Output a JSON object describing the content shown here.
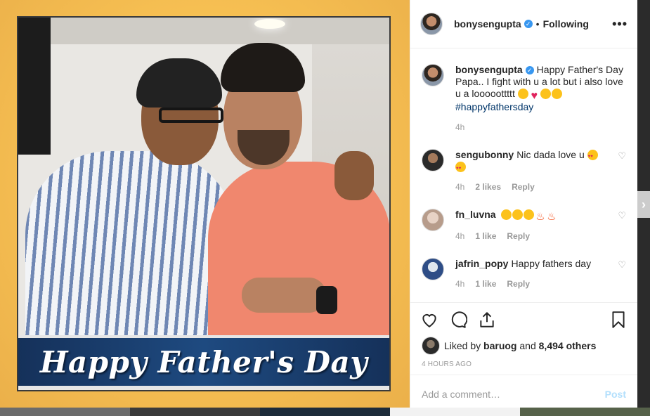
{
  "photo": {
    "banner_text": "Happy Father's Day"
  },
  "header": {
    "username": "bonysengupta",
    "separator": "•",
    "follow_label": "Following",
    "more_label": "•••"
  },
  "caption": {
    "username": "bonysengupta",
    "text": "Happy Father's Day Papa.. I fight with u a lot but i also love u a looooottttt",
    "hashtag": "#happyfathersday",
    "time": "4h"
  },
  "comments": [
    {
      "username": "sengubonny",
      "text": "Nic dada love u",
      "time": "4h",
      "likes": "2 likes",
      "reply": "Reply"
    },
    {
      "username": "fn_luvna",
      "text": "",
      "time": "4h",
      "likes": "1 like",
      "reply": "Reply"
    },
    {
      "username": "jafrin_popy",
      "text": "Happy fathers day",
      "time": "4h",
      "likes": "1 like",
      "reply": "Reply"
    }
  ],
  "likes": {
    "prefix": "Liked by",
    "user": "baruog",
    "and": "and",
    "others": "8,494 others"
  },
  "timestamp": "4 HOURS AGO",
  "add_comment": {
    "placeholder": "Add a comment…",
    "post_label": "Post"
  },
  "colors": {
    "link": "#003569",
    "verified": "#3897f0",
    "post_disabled": "#b2dffc",
    "backdrop": "#f6bf52"
  },
  "icons": [
    "heart-icon",
    "comment-icon",
    "share-icon",
    "bookmark-icon",
    "more-options-icon",
    "verified-badge-icon",
    "next-arrow-icon"
  ]
}
